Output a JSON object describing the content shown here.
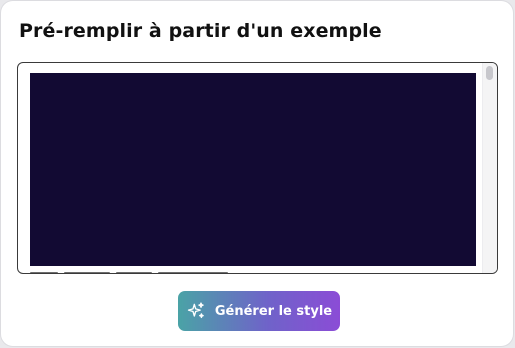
{
  "modal": {
    "title": "Pré-remplir à partir d'un exemple"
  },
  "preview": {
    "canvas_color": "#120a33"
  },
  "actions": {
    "generate_label": "Générer le style",
    "generate_icon": "sparkles-icon",
    "gradient": [
      "#4aa3a6",
      "#6f63c9",
      "#8b4cd6"
    ]
  }
}
